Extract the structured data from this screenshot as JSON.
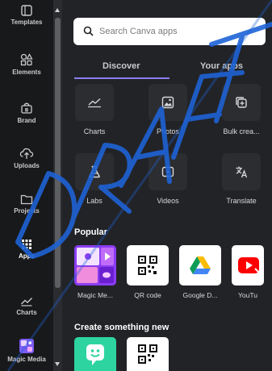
{
  "sidebar": {
    "items": [
      {
        "label": "Templates",
        "icon": "templates-icon"
      },
      {
        "label": "Elements",
        "icon": "elements-icon"
      },
      {
        "label": "Brand",
        "icon": "brand-icon"
      },
      {
        "label": "Uploads",
        "icon": "cloud-upload-icon"
      },
      {
        "label": "Projects",
        "icon": "folder-icon"
      },
      {
        "label": "Apps",
        "icon": "apps-grid-icon",
        "active": true
      },
      {
        "label": "Charts",
        "icon": "chart-icon"
      },
      {
        "label": "Magic Media",
        "icon": "magic-media-icon"
      }
    ]
  },
  "search": {
    "placeholder": "Search Canva apps"
  },
  "tabs": [
    {
      "label": "Discover",
      "active": true
    },
    {
      "label": "Your apps",
      "active": false
    }
  ],
  "tools": [
    {
      "label": "Charts",
      "icon": "chart-line-icon"
    },
    {
      "label": "Photos",
      "icon": "photo-icon"
    },
    {
      "label": "Bulk crea...",
      "icon": "bulk-create-icon"
    },
    {
      "label": "Labs",
      "icon": "flask-icon"
    },
    {
      "label": "Videos",
      "icon": "video-icon"
    },
    {
      "label": "Translate",
      "icon": "translate-icon"
    }
  ],
  "popular": {
    "title": "Popular",
    "apps": [
      {
        "label": "Magic Me...",
        "icon": "magic-media-app-icon"
      },
      {
        "label": "QR code",
        "icon": "qr-code-icon"
      },
      {
        "label": "Google D...",
        "icon": "google-drive-icon"
      },
      {
        "label": "YouTu",
        "icon": "youtube-icon"
      }
    ]
  },
  "create": {
    "title": "Create something new",
    "apps": [
      {
        "icon": "smiley-app-icon"
      },
      {
        "icon": "qr-code-icon"
      }
    ]
  },
  "colors": {
    "accent": "#8b7ff0",
    "panel": "#222327",
    "rail": "#18191b",
    "watermark": "#1e63d6"
  },
  "watermark": {
    "text": "DRAFT"
  }
}
